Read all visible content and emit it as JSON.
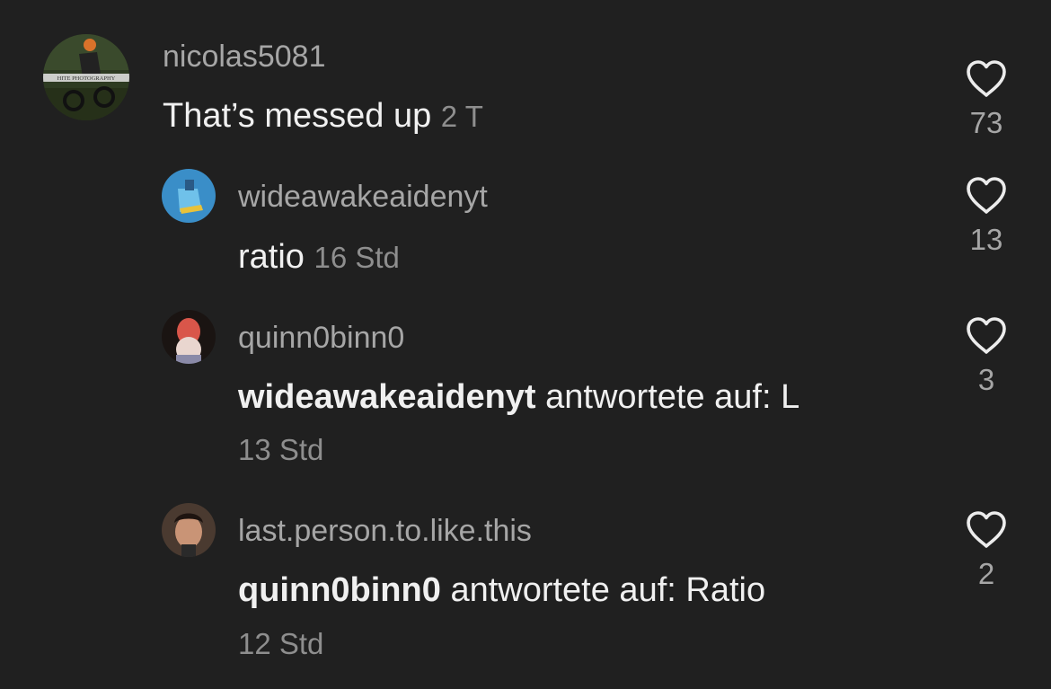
{
  "colors": {
    "background": "#202020",
    "username": "#a6a6a6",
    "text": "#f0f0f0",
    "muted": "#8e8e8e"
  },
  "comments": [
    {
      "username": "nicolas5081",
      "text": "That’s messed up",
      "time": "2 T",
      "likes": "73",
      "avatar_caption": "HITE PHOTOGRAPHY"
    },
    {
      "username": "wideawakeaidenyt",
      "text": "ratio",
      "time": "16 Std",
      "likes": "13"
    },
    {
      "username": "quinn0binn0",
      "reply_to": "wideawakeaidenyt",
      "reply_label": "antwortete auf: L",
      "time": "13 Std",
      "likes": "3"
    },
    {
      "username": "last.person.to.like.this",
      "reply_to": "quinn0binn0",
      "reply_label": "antwortete auf: Ratio",
      "time": "12 Std",
      "likes": "2"
    }
  ]
}
